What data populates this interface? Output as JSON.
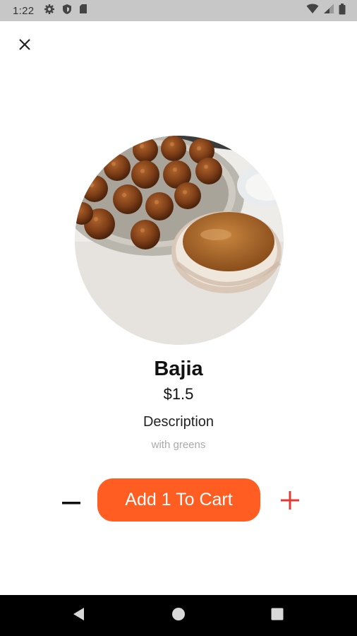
{
  "status_bar": {
    "time": "1:22",
    "left_icons": [
      "settings-icon",
      "shield-icon",
      "sd-card-icon"
    ],
    "right_icons": [
      "wifi-icon",
      "signal-icon",
      "battery-icon"
    ]
  },
  "header": {
    "close_icon": "close-icon"
  },
  "item": {
    "name": "Bajia",
    "price": "$1.5",
    "description_heading": "Description",
    "description": "with greens"
  },
  "cart": {
    "minus_icon": "minus-icon",
    "add_label": "Add 1 To Cart",
    "plus_icon": "plus-icon",
    "quantity": 1
  },
  "colors": {
    "accent": "#ff5d22",
    "plus": "#e53935",
    "status_bar": "#c7c7c7",
    "nav_bar": "#000000"
  },
  "nav_bar": {
    "buttons": [
      "back-icon",
      "home-icon",
      "recents-icon"
    ]
  }
}
